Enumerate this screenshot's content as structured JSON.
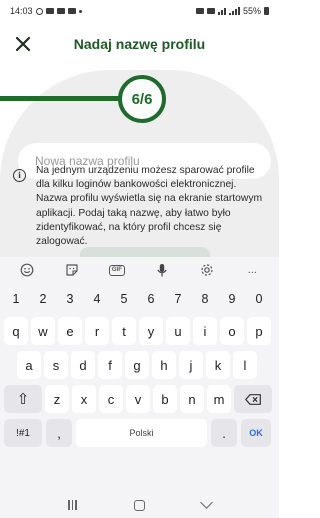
{
  "status_bar": {
    "time": "14:03",
    "battery": "55%"
  },
  "header": {
    "title": "Nadaj nazwę profilu"
  },
  "progress": {
    "step_label": "6/6",
    "fraction_complete": 1.0
  },
  "profile_name_input": {
    "placeholder": "Nowa nazwa profilu",
    "value": ""
  },
  "info": {
    "text": "Na jednym urządzeniu możesz sparować profile dla kilku loginów bankowości elektronicznej. Nazwa profilu wyświetla się na ekranie startowym aplikacji. Podaj taką nazwę, aby łatwo było zidentyfikować, na który profil chcesz się zalogować."
  },
  "keyboard": {
    "toolbar_icons": [
      "emoji-icon",
      "sticker-icon",
      "gif-icon",
      "microphone-icon",
      "settings-icon",
      "more-icon"
    ],
    "gif_label": "GIF",
    "more_label": "...",
    "number_row": [
      "1",
      "2",
      "3",
      "4",
      "5",
      "6",
      "7",
      "8",
      "9",
      "0"
    ],
    "row1": [
      "q",
      "w",
      "e",
      "r",
      "t",
      "y",
      "u",
      "i",
      "o",
      "p"
    ],
    "row2": [
      "a",
      "s",
      "d",
      "f",
      "g",
      "h",
      "j",
      "k",
      "l"
    ],
    "row3": [
      "z",
      "x",
      "c",
      "v",
      "b",
      "n",
      "m"
    ],
    "symbols_label": "!#1",
    "comma_label": ",",
    "space_label": "Polski",
    "period_label": ".",
    "ok_label": "OK",
    "shift_glyph": "⇧"
  },
  "colors": {
    "brand_green": "#1f6b2c",
    "title_green": "#1e5a27",
    "ok_blue": "#2b6de4"
  }
}
